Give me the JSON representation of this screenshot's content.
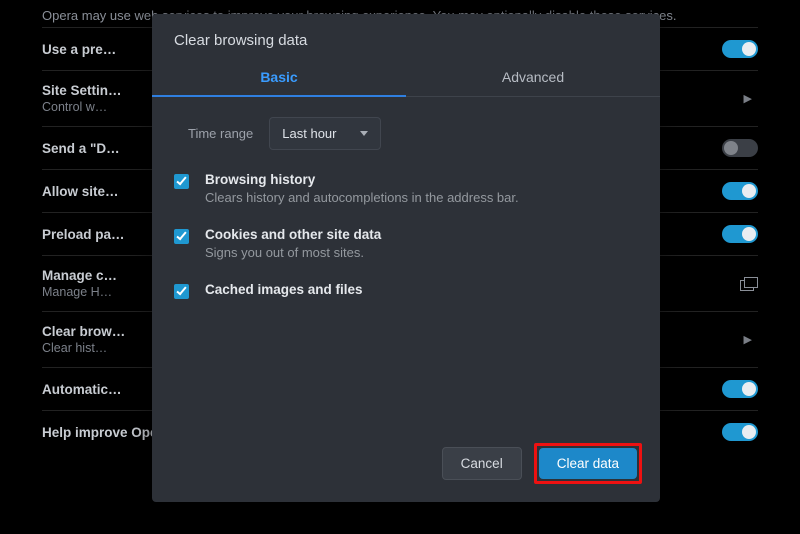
{
  "intro": "Opera may use web services to improve your browsing experience. You may optionally disable these services.",
  "rows": [
    {
      "title": "Use a pre…",
      "sub": "",
      "toggle": "on"
    },
    {
      "title": "Site Settin…",
      "sub": "Control w…",
      "right": "arrow"
    },
    {
      "title": "Send a \"D…",
      "sub": "",
      "toggle": "off"
    },
    {
      "title": "Allow site…",
      "sub": "",
      "toggle": "on"
    },
    {
      "title": "Preload pa…",
      "sub": "",
      "toggle": "on"
    },
    {
      "title": "Manage c…",
      "sub": "Manage H…",
      "right": "open"
    },
    {
      "title": "Clear brow…",
      "sub": "Clear hist…",
      "right": "arrow"
    },
    {
      "title": "Automatic…",
      "sub": "",
      "toggle": "on"
    },
    {
      "title": "Help improve Opera by sending feature usage information  Learn more",
      "sub": "",
      "toggle": "on"
    }
  ],
  "dialog": {
    "title": "Clear browsing data",
    "tabs": {
      "basic": "Basic",
      "advanced": "Advanced"
    },
    "time_range_label": "Time range",
    "time_range_value": "Last hour",
    "items": [
      {
        "title": "Browsing history",
        "sub": "Clears history and autocompletions in the address bar."
      },
      {
        "title": "Cookies and other site data",
        "sub": "Signs you out of most sites."
      },
      {
        "title": "Cached images and files",
        "sub": ""
      }
    ],
    "cancel": "Cancel",
    "clear": "Clear data"
  }
}
